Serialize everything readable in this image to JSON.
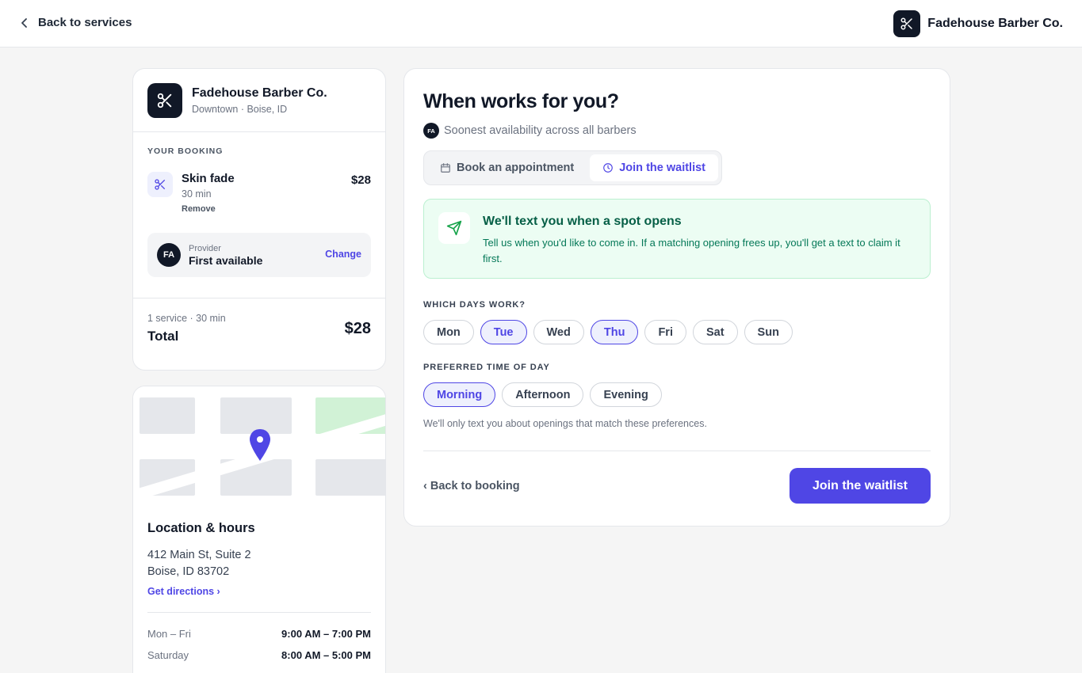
{
  "topbar": {
    "back_label": "Back to services",
    "brand_name": "Fadehouse Barber Co."
  },
  "summary": {
    "shop_name": "Fadehouse Barber Co.",
    "shop_location": "Downtown · Boise, ID",
    "section_label": "YOUR BOOKING",
    "service": {
      "name": "Skin fade",
      "duration": "30 min",
      "remove_label": "Remove",
      "price": "$28"
    },
    "provider": {
      "initials": "FA",
      "label": "Provider",
      "value": "First available",
      "change_label": "Change"
    },
    "total": {
      "meta": "1 service · 30 min",
      "label": "Total",
      "price": "$28"
    }
  },
  "location": {
    "title": "Location & hours",
    "address_line1": "412 Main St, Suite 2",
    "address_line2": "Boise, ID 83702",
    "directions_label": "Get directions ›",
    "hours": [
      {
        "day": "Mon – Fri",
        "time": "9:00 AM – 7:00 PM"
      },
      {
        "day": "Saturday",
        "time": "8:00 AM – 5:00 PM"
      }
    ]
  },
  "main": {
    "title": "When works for you?",
    "availability": {
      "initials": "FA",
      "text": "Soonest availability across all barbers"
    },
    "tabs": [
      {
        "label": "Book an appointment",
        "active": false
      },
      {
        "label": "Join the waitlist",
        "active": true
      }
    ],
    "info": {
      "title": "We'll text you when a spot opens",
      "text": "Tell us when you'd like to come in. If a matching opening frees up, you'll get a text to claim it first."
    },
    "days_label": "WHICH DAYS WORK?",
    "days": [
      {
        "label": "Mon",
        "selected": false
      },
      {
        "label": "Tue",
        "selected": true
      },
      {
        "label": "Wed",
        "selected": false
      },
      {
        "label": "Thu",
        "selected": true
      },
      {
        "label": "Fri",
        "selected": false
      },
      {
        "label": "Sat",
        "selected": false
      },
      {
        "label": "Sun",
        "selected": false
      }
    ],
    "time_label": "PREFERRED TIME OF DAY",
    "times": [
      {
        "label": "Morning",
        "selected": true
      },
      {
        "label": "Afternoon",
        "selected": false
      },
      {
        "label": "Evening",
        "selected": false
      }
    ],
    "hint": "We'll only text you about openings that match these preferences.",
    "back_label": "‹ Back to booking",
    "submit_label": "Join the waitlist"
  },
  "colors": {
    "accent": "#4f46e5",
    "success_bg": "#ecfdf3",
    "success_text": "#065f46",
    "dark": "#111827"
  },
  "icons": [
    "chevron-left-icon",
    "scissors-icon",
    "calendar-icon",
    "clock-icon",
    "send-icon",
    "map-pin-icon"
  ]
}
